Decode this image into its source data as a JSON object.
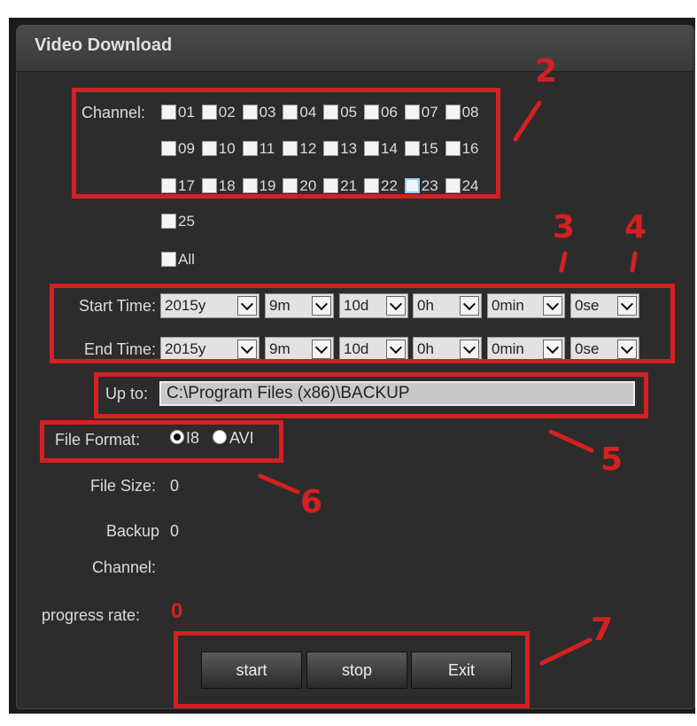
{
  "window": {
    "title": "Video Download"
  },
  "channel": {
    "label": "Channel:",
    "rows": [
      [
        "01",
        "02",
        "03",
        "04",
        "05",
        "06",
        "07",
        "08"
      ],
      [
        "09",
        "10",
        "11",
        "12",
        "13",
        "14",
        "15",
        "16"
      ],
      [
        "17",
        "18",
        "19",
        "20",
        "21",
        "22",
        "23",
        "24"
      ],
      [
        "25"
      ],
      [
        "All"
      ]
    ]
  },
  "start_time": {
    "label": "Start Time:",
    "year": "2015y",
    "month": "9m",
    "day": "10d",
    "hour": "0h",
    "minute": "0min",
    "second": "0se"
  },
  "end_time": {
    "label": "End Time:",
    "year": "2015y",
    "month": "9m",
    "day": "10d",
    "hour": "0h",
    "minute": "0min",
    "second": "0se"
  },
  "up_to": {
    "label": "Up to:",
    "value": "C:\\Program Files (x86)\\BACKUP"
  },
  "file_format": {
    "label": "File Format:",
    "options": [
      "I8",
      "AVI"
    ],
    "selected": "I8"
  },
  "file_size": {
    "label": "File Size:",
    "value": "0"
  },
  "backup_channel": {
    "label_line1": "Backup",
    "label_line2": "Channel:",
    "value": "0"
  },
  "progress": {
    "label": "progress rate:",
    "value": "0"
  },
  "buttons": {
    "start": "start",
    "stop": "stop",
    "exit": "Exit"
  },
  "annotations": {
    "n2": "2",
    "n3": "3",
    "n4": "4",
    "n5": "5",
    "n6": "6",
    "n7": "7"
  },
  "colors": {
    "annotation": "#d42020",
    "panel": "#2c2c2c",
    "text": "#dcdcdc"
  }
}
